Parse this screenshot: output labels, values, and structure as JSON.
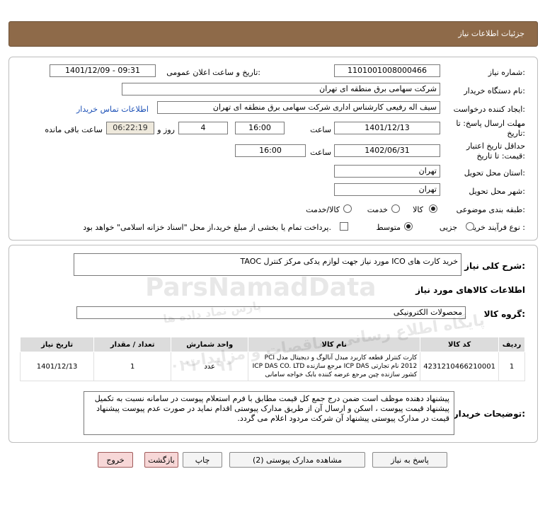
{
  "page": {
    "title": "جزئیات اطلاعات نیاز"
  },
  "form": {
    "need_number_label": "شماره نیاز:",
    "need_number": "1101001008000466",
    "announce_label": "تاریخ و ساعت اعلان عمومی:",
    "announce_value": "1401/12/09 - 09:31",
    "buyer_org_label": "نام دستگاه خریدار:",
    "buyer_org": "شرکت سهامی برق منطقه ای تهران",
    "creator_label": "ایجاد کننده درخواست:",
    "creator": "سیف اله رفیعی کارشناس اداری شرکت سهامی برق منطقه ای تهران",
    "contact_link": "اطلاعات تماس خریدار",
    "deadline_label_1": "مهلت ارسال پاسخ: تا",
    "deadline_label_2": "تاریخ:",
    "deadline_date": "1401/12/13",
    "time_label": "ساعت",
    "deadline_time": "16:00",
    "days_value": "4",
    "days_label": "روز و",
    "remaining_time": "06:22:19",
    "remaining_label": "ساعت باقی مانده",
    "validity_label_1": "حداقل تاریخ اعتبار",
    "validity_label_2": "قیمت: تا تاریخ:",
    "validity_date": "1402/06/31",
    "validity_time_label": "ساعت",
    "validity_time": "16:00",
    "province_label": "استان محل تحویل:",
    "province": "تهران",
    "city_label": "شهر محل تحویل:",
    "city": "تهران",
    "category_label": "طبقه بندی موضوعی:",
    "category_options": [
      "کالا",
      "خدمت",
      "کالا/خدمت"
    ],
    "category_selected": "کالا",
    "process_label": "نوع فرآیند خرید :",
    "process_options": [
      "جزیی",
      "متوسط"
    ],
    "process_selected": "متوسط",
    "payment_note": "پرداخت تمام یا بخشی از مبلغ خرید،از محل \"اسناد خزانه اسلامی\" خواهد بود."
  },
  "details": {
    "summary_label": "شرح کلی نیاز:",
    "summary": "خرید کارت های ICO مورد نیاز جهت لوازم یدکی مرکز کنترل TAOC",
    "goods_info_title": "اطلاعات کالاهای مورد نیاز",
    "goods_group_label": "گروه کالا:",
    "goods_group": "محصولات الکترونیکی",
    "table": {
      "headers": [
        "ردیف",
        "کد کالا",
        "نام کالا",
        "واحد شمارش",
        "تعداد / مقدار",
        "تاریخ نیاز"
      ],
      "rows": [
        {
          "row": "1",
          "code": "4231210466210001",
          "name": "کارت کنترلر قطعه کاربرد مبدل آنالوگ و دیجیتال مدل PCI 2012 نام تجارتی ICP DAS مرجع سازنده ICP DAS CO. LTD کشور سازنده چین مرجع عرضه کننده بابک خواجه سامانی",
          "unit": "عدد",
          "qty": "1",
          "date": "1401/12/13"
        }
      ]
    },
    "buyer_notes_label": "توضیحات خریدار:",
    "buyer_notes": "پیشنهاد دهنده موظف است ضمن درج جمع کل قیمت مطابق با فرم استعلام پیوست در سامانه نسبت به تکمیل پیشنهاد قیمت پیوست ، اسکن و ارسال آن از طریق مدارک پیوستی اقدام نماید در صورت عدم پیوست پیشنهاد قیمت در مدارک پیوستی پیشنهاد آن شرکت مردود اعلام می گردد."
  },
  "buttons": {
    "reply": "پاسخ به نیاز",
    "attachments": "مشاهده مدارک پیوستی (2)",
    "print": "چاپ",
    "back": "بازگشت",
    "exit": "خروج"
  },
  "watermark": {
    "brand": "ParsNamadData",
    "line1": "پایگاه اطلاع رسانی مناقصات و مزایدات",
    "line2": "پارس نماد داده ها",
    "phone": "۰۲۱ - ۹۱"
  }
}
